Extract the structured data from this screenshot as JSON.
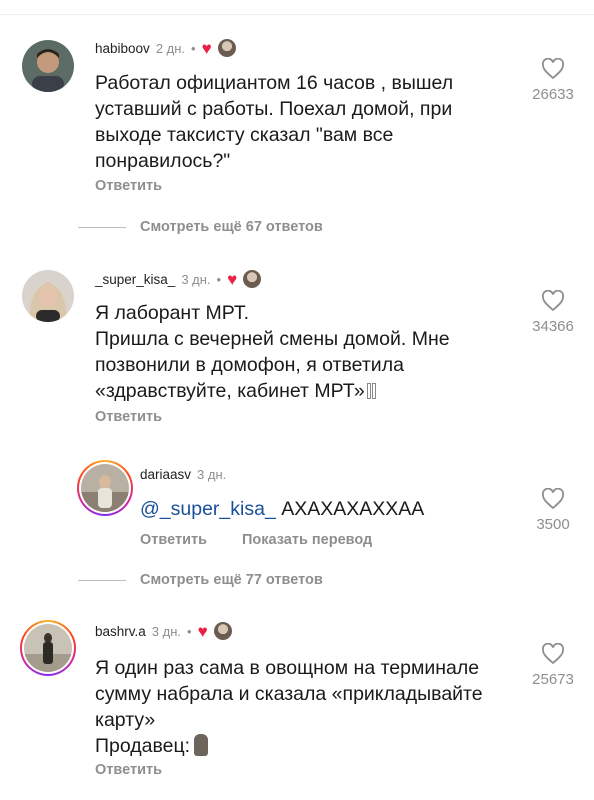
{
  "comments": [
    {
      "user": "habiboov",
      "time": "2 дн.",
      "dot": "•",
      "text": "Работал официантом 16 часов , вышел\nуставший с работы. Поехал домой, при\nвыходе таксисту сказал \"вам все\nпонравилось?\"",
      "likes": "26633",
      "reply_label": "Ответить",
      "more_replies": "Смотреть ещё 67 ответов"
    },
    {
      "user": "_super_kisa_",
      "time": "3 дн.",
      "dot": "•",
      "text": "Я лаборант МРТ.\nПришла с вечерней смены домой. Мне\nпозвонили в домофон, я ответила\n«здравствуйте, кабинет МРТ»",
      "likes": "34366",
      "reply_label": "Ответить",
      "more_replies": "Смотреть ещё 77 ответов"
    },
    {
      "user": "bashrv.a",
      "time": "3 дн.",
      "dot": "•",
      "text": "Я один раз сама в овощном на терминале\nсумму набрала и сказала «прикладывайте\nкарту»\nПродавец:",
      "likes": "25673",
      "reply_label": "Ответить"
    }
  ],
  "nested_reply": {
    "user": "dariaasv",
    "time": "3 дн.",
    "mention": "@_super_kisa_",
    "text": " АХАХАХАХХАА",
    "likes": "3500",
    "reply_label": "Ответить",
    "translate_label": "Показать перевод"
  },
  "colors": {
    "heart": "#ed1f45",
    "muted": "#8e8e8e",
    "mention": "#1a4f9c"
  }
}
